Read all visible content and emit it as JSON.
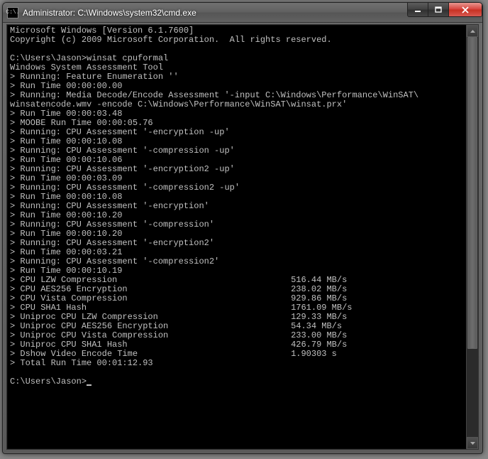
{
  "window": {
    "title": "Administrator: C:\\Windows\\system32\\cmd.exe",
    "icon_text": "C:\\."
  },
  "header_lines": [
    "Microsoft Windows [Version 6.1.7600]",
    "Copyright (c) 2009 Microsoft Corporation.  All rights reserved.",
    ""
  ],
  "prompt1": "C:\\Users\\Jason>",
  "cmd1": "winsat cpuformal",
  "assessment_lines": [
    "Windows System Assessment Tool",
    "> Running: Feature Enumeration ''",
    "> Run Time 00:00:00.00",
    "> Running: Media Decode/Encode Assessment '-input C:\\Windows\\Performance\\WinSAT\\",
    "winsatencode.wmv -encode C:\\Windows\\Performance\\WinSAT\\winsat.prx'",
    "> Run Time 00:00:03.48",
    "> MOOBE Run Time 00:00:05.76",
    "> Running: CPU Assessment '-encryption -up'",
    "> Run Time 00:00:10.08",
    "> Running: CPU Assessment '-compression -up'",
    "> Run Time 00:00:10.06",
    "> Running: CPU Assessment '-encryption2 -up'",
    "> Run Time 00:00:03.09",
    "> Running: CPU Assessment '-compression2 -up'",
    "> Run Time 00:00:10.08",
    "> Running: CPU Assessment '-encryption'",
    "> Run Time 00:00:10.20",
    "> Running: CPU Assessment '-compression'",
    "> Run Time 00:00:10.20",
    "> Running: CPU Assessment '-encryption2'",
    "> Run Time 00:00:03.21",
    "> Running: CPU Assessment '-compression2'",
    "> Run Time 00:00:10.19"
  ],
  "results": [
    {
      "label": "> CPU LZW Compression",
      "value": "516.44 MB/s"
    },
    {
      "label": "> CPU AES256 Encryption",
      "value": "238.02 MB/s"
    },
    {
      "label": "> CPU Vista Compression",
      "value": "929.86 MB/s"
    },
    {
      "label": "> CPU SHA1 Hash",
      "value": "1761.09 MB/s"
    },
    {
      "label": "> Uniproc CPU LZW Compression",
      "value": "129.33 MB/s"
    },
    {
      "label": "> Uniproc CPU AES256 Encryption",
      "value": "54.34 MB/s"
    },
    {
      "label": "> Uniproc CPU Vista Compression",
      "value": "233.00 MB/s"
    },
    {
      "label": "> Uniproc CPU SHA1 Hash",
      "value": "426.79 MB/s"
    },
    {
      "label": "> Dshow Video Encode Time",
      "value": "1.90303 s"
    }
  ],
  "total_line": "> Total Run Time 00:01:12.93",
  "prompt2": "C:\\Users\\Jason>"
}
